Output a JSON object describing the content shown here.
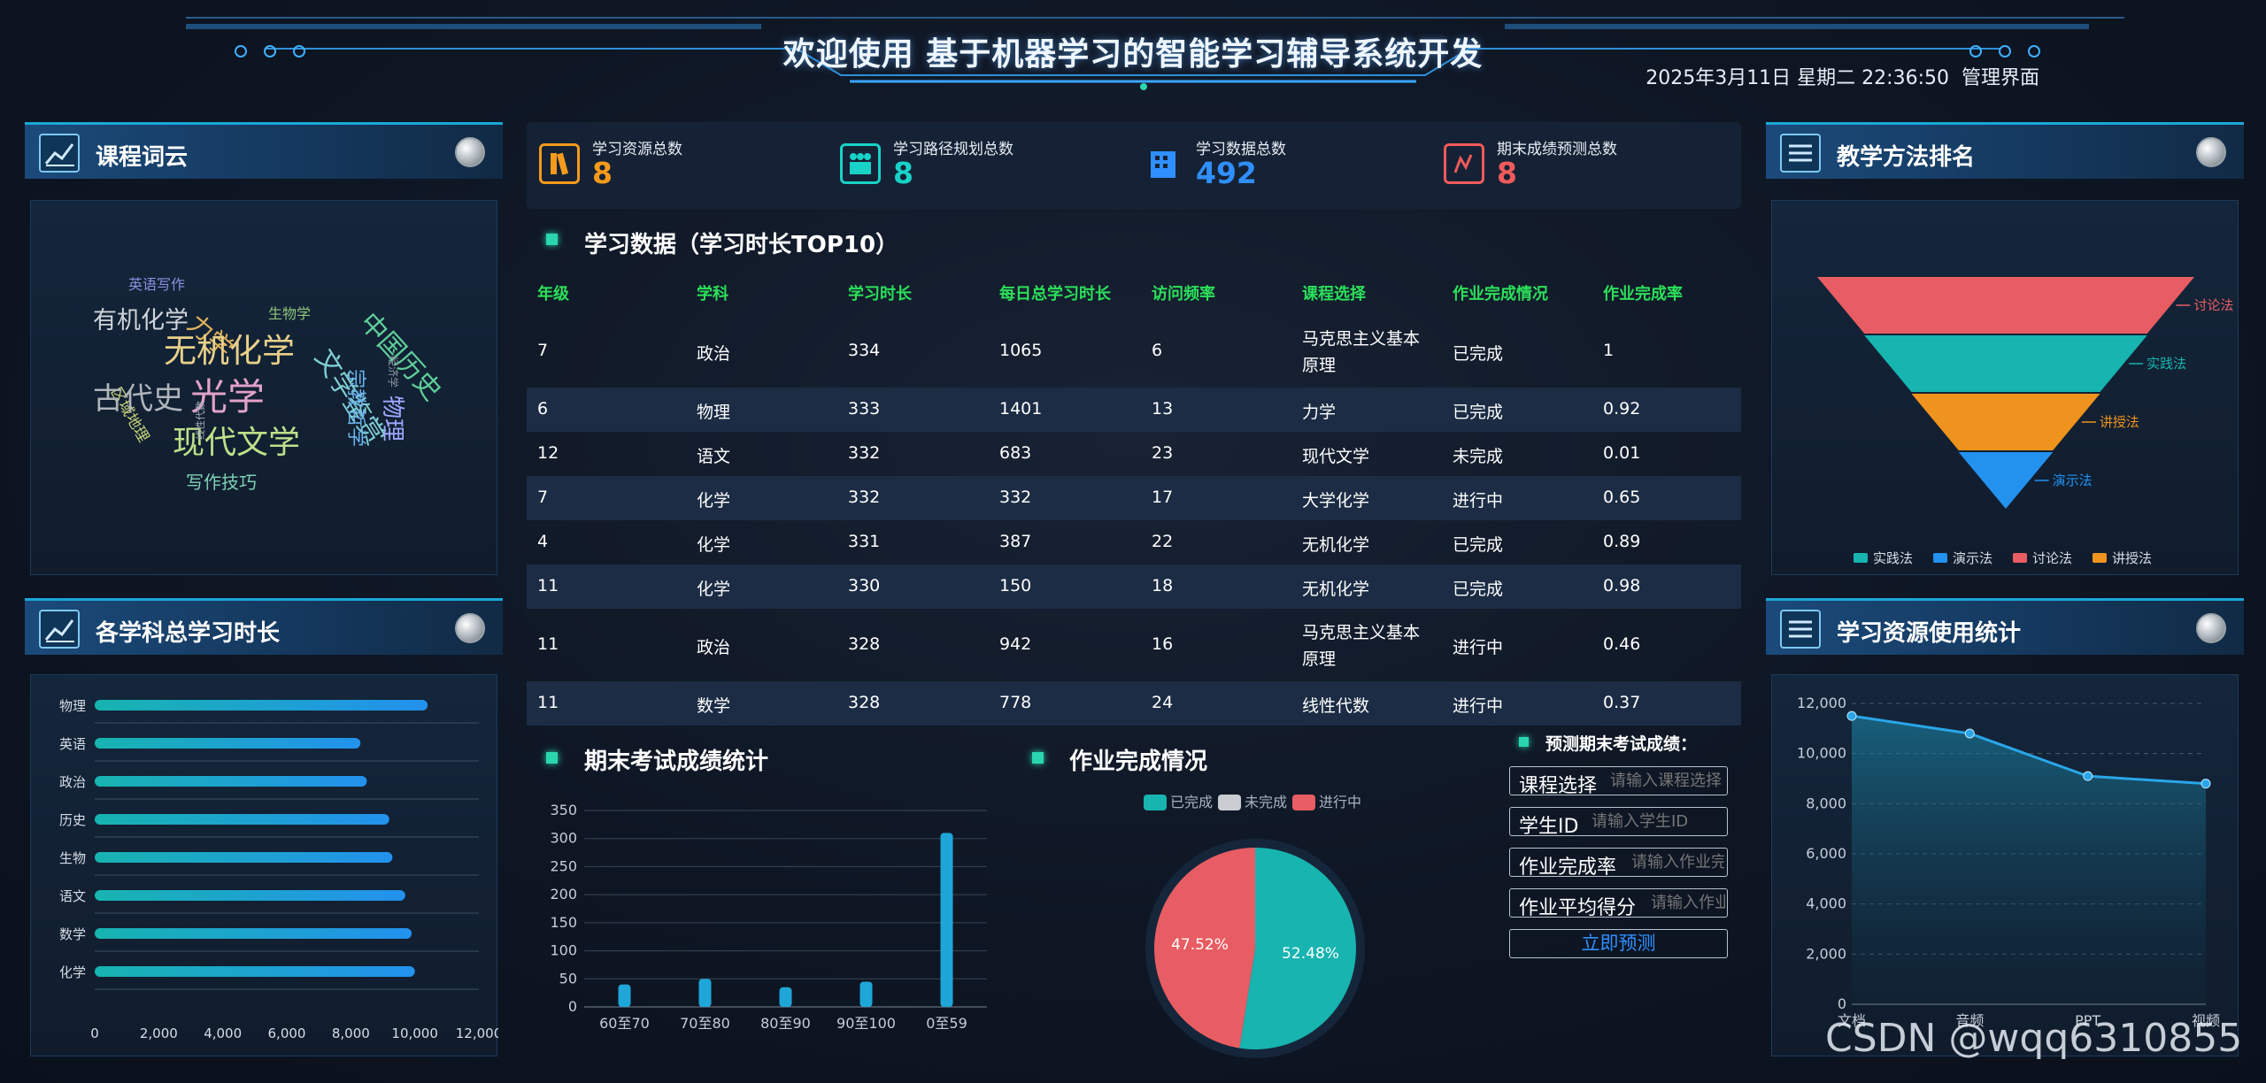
{
  "header": {
    "title": "欢迎使用 基于机器学习的智能学习辅导系统开发",
    "datetime": "2025年3月11日 星期二 22:36:50",
    "admin_link": "管理界面"
  },
  "panels": {
    "word_cloud_title": "课程词云",
    "subject_hours_title": "各学科总学习时长",
    "method_rank_title": "教学方法排名",
    "resource_usage_title": "学习资源使用统计"
  },
  "word_cloud": [
    {
      "text": "英语写作",
      "color": "#8a8fe0"
    },
    {
      "text": "有机化学",
      "color": "#d0d4da"
    },
    {
      "text": "力学",
      "color": "#e0b45a"
    },
    {
      "text": "生物学",
      "color": "#8ec67a"
    },
    {
      "text": "文学鉴赏",
      "color": "#7fcfd4"
    },
    {
      "text": "中国历史",
      "color": "#5fcf9a"
    },
    {
      "text": "无机化学",
      "color": "#e8d08a"
    },
    {
      "text": "区域地理",
      "color": "#c8d47a"
    },
    {
      "text": "古代史",
      "color": "#b0b5bc"
    },
    {
      "text": "光学",
      "color": "#e2a2c8"
    },
    {
      "text": "宗教哲学",
      "color": "#6ab4ec"
    },
    {
      "text": "物理",
      "color": "#9ea8ff"
    },
    {
      "text": "现代文学",
      "color": "#bfe08a"
    },
    {
      "text": "写作技巧",
      "color": "#7fd0b4"
    },
    {
      "text": "线性代数",
      "color": "#a6b0bc"
    },
    {
      "text": "经济学",
      "color": "#8e96a2"
    }
  ],
  "stats": [
    {
      "label": "学习资源总数",
      "value": "8",
      "color": "#f59a1b",
      "icon": "books-icon"
    },
    {
      "label": "学习路径规划总数",
      "value": "8",
      "color": "#18d2c8",
      "icon": "people-icon"
    },
    {
      "label": "学习数据总数",
      "value": "492",
      "color": "#2f8fff",
      "icon": "building-icon"
    },
    {
      "label": "期末成绩预测总数",
      "value": "8",
      "color": "#f05a5a",
      "icon": "chart-box-icon"
    }
  ],
  "study_table": {
    "title": "学习数据（学习时长TOP10）",
    "headers": [
      "年级",
      "学科",
      "学习时长",
      "每日总学习时长",
      "访问频率",
      "课程选择",
      "作业完成情况",
      "作业完成率"
    ],
    "rows": [
      [
        "7",
        "政治",
        "334",
        "1065",
        "6",
        "马克思主义基本原理",
        "已完成",
        "1"
      ],
      [
        "6",
        "物理",
        "333",
        "1401",
        "13",
        "力学",
        "已完成",
        "0.92"
      ],
      [
        "12",
        "语文",
        "332",
        "683",
        "23",
        "现代文学",
        "未完成",
        "0.01"
      ],
      [
        "7",
        "化学",
        "332",
        "332",
        "17",
        "大学化学",
        "进行中",
        "0.65"
      ],
      [
        "4",
        "化学",
        "331",
        "387",
        "22",
        "无机化学",
        "已完成",
        "0.89"
      ],
      [
        "11",
        "化学",
        "330",
        "150",
        "18",
        "无机化学",
        "已完成",
        "0.98"
      ],
      [
        "11",
        "政治",
        "328",
        "942",
        "16",
        "马克思主义基本原理",
        "进行中",
        "0.46"
      ],
      [
        "11",
        "数学",
        "328",
        "778",
        "24",
        "线性代数",
        "进行中",
        "0.37"
      ]
    ]
  },
  "exam_chart_title": "期末考试成绩统计",
  "homework_chart_title": "作业完成情况",
  "predict_form": {
    "title": "预测期末考试成绩：",
    "fields": [
      {
        "label": "课程选择",
        "placeholder": "请输入课程选择"
      },
      {
        "label": "学生ID",
        "placeholder": "请输入学生ID"
      },
      {
        "label": "作业完成率",
        "placeholder": "请输入作业完成率"
      },
      {
        "label": "作业平均得分",
        "placeholder": "请输入作业平均得分"
      }
    ],
    "submit_label": "立即预测"
  },
  "watermark": "CSDN @wqq6310855",
  "chart_data": [
    {
      "id": "subject_hours",
      "type": "bar",
      "orientation": "horizontal",
      "categories": [
        "物理",
        "英语",
        "政治",
        "历史",
        "生物",
        "语文",
        "数学",
        "化学"
      ],
      "values": [
        10400,
        8300,
        8500,
        9200,
        9300,
        9700,
        9900,
        10000
      ],
      "xlim": [
        0,
        12000
      ],
      "xticks": [
        "0",
        "2,000",
        "4,000",
        "6,000",
        "8,000",
        "10,000",
        "12,000"
      ]
    },
    {
      "id": "teaching_methods",
      "type": "funnel",
      "categories": [
        "讨论法",
        "实践法",
        "讲授法",
        "演示法"
      ],
      "values": [
        100,
        75,
        50,
        25
      ],
      "colors": [
        "#e85d63",
        "#17b4b0",
        "#ee931d",
        "#2391ee"
      ],
      "legend": [
        "实践法",
        "演示法",
        "讨论法",
        "讲授法"
      ],
      "legend_colors": [
        "#17b4b0",
        "#2391ee",
        "#e85d63",
        "#ee931d"
      ]
    },
    {
      "id": "exam_scores",
      "type": "bar",
      "categories": [
        "60至70",
        "70至80",
        "80至90",
        "90至100",
        "0至59"
      ],
      "values": [
        40,
        50,
        35,
        45,
        310
      ],
      "ylim": [
        0,
        350
      ],
      "yticks": [
        "0",
        "50",
        "100",
        "150",
        "200",
        "250",
        "300",
        "350"
      ]
    },
    {
      "id": "homework_completion",
      "type": "pie",
      "legend": [
        "已完成",
        "未完成",
        "进行中"
      ],
      "legend_colors": [
        "#17b4b0",
        "#c9cdd2",
        "#e85d63"
      ],
      "slices": [
        {
          "name": "已完成",
          "value": 52.48,
          "label": "52.48%",
          "color": "#17b4b0"
        },
        {
          "name": "进行中",
          "value": 47.52,
          "label": "47.52%",
          "color": "#e85d63"
        }
      ]
    },
    {
      "id": "resource_usage",
      "type": "area",
      "categories": [
        "文档",
        "音频",
        "PPT",
        "视频"
      ],
      "values": [
        11500,
        10800,
        9100,
        8800
      ],
      "ylim": [
        0,
        12000
      ],
      "yticks": [
        "0",
        "2,000",
        "4,000",
        "6,000",
        "8,000",
        "10,000",
        "12,000"
      ],
      "grid": true
    }
  ]
}
